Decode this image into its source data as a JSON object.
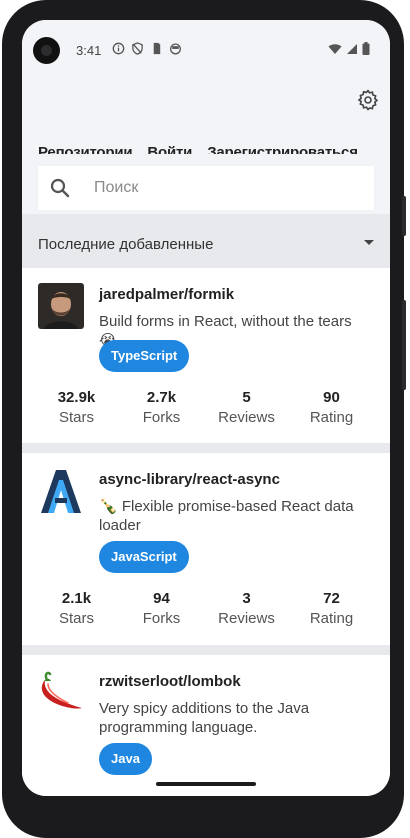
{
  "status_bar": {
    "time": "3:41",
    "left_icons": [
      "info-icon",
      "shield-icon",
      "sim-icon",
      "android-icon"
    ],
    "right_icons": [
      "wifi-icon",
      "signal-icon",
      "battery-icon"
    ]
  },
  "header": {
    "settings_icon": "gear-icon",
    "tabs": [
      {
        "label": "Репозитории"
      },
      {
        "label": "Войти"
      },
      {
        "label": "Зарегистрироваться"
      }
    ]
  },
  "search": {
    "placeholder": "Поиск",
    "value": ""
  },
  "sort": {
    "selected": "Последние добавленные"
  },
  "repositories": [
    {
      "name": "jaredpalmer/formik",
      "description": "Build forms in React, without the tears 😭",
      "language": "TypeScript",
      "avatar": "person-photo",
      "stats": [
        {
          "value": "32.9k",
          "label": "Stars"
        },
        {
          "value": "2.7k",
          "label": "Forks"
        },
        {
          "value": "5",
          "label": "Reviews"
        },
        {
          "value": "90",
          "label": "Rating"
        }
      ]
    },
    {
      "name": "async-library/react-async",
      "description": "🍾 Flexible promise-based React data loader",
      "language": "JavaScript",
      "avatar": "letter-a-logo",
      "stats": [
        {
          "value": "2.1k",
          "label": "Stars"
        },
        {
          "value": "94",
          "label": "Forks"
        },
        {
          "value": "3",
          "label": "Reviews"
        },
        {
          "value": "72",
          "label": "Rating"
        }
      ]
    },
    {
      "name": "rzwitserloot/lombok",
      "description": "Very spicy additions to the Java programming language.",
      "language": "Java",
      "avatar": "chili-pepper-logo"
    }
  ],
  "colors": {
    "accent": "#1f87e0",
    "header_bg": "#f2f4f8",
    "separator": "#e8e9ed"
  }
}
